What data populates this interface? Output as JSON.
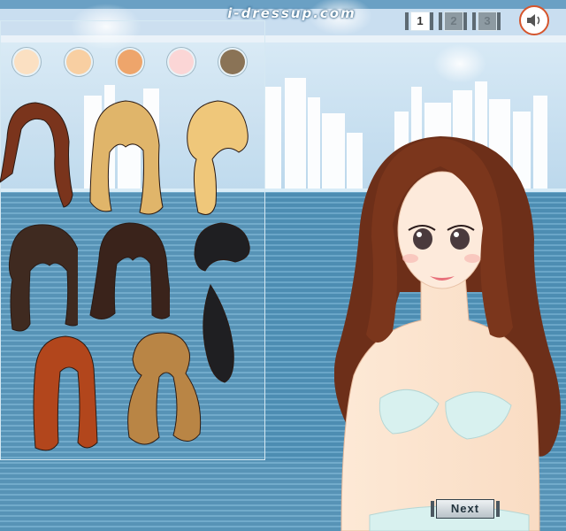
{
  "header": {
    "site_title": "i-dressup.com"
  },
  "pagination": {
    "pages": [
      "1",
      "2",
      "3"
    ],
    "current": "1"
  },
  "sound": {
    "icon": "speaker-icon"
  },
  "skin_tones": {
    "colors": [
      "#fbe0c2",
      "#f8cfa2",
      "#eea56b",
      "#fbd6d6",
      "#8a7356"
    ]
  },
  "hair_options": [
    {
      "name": "long-wavy-auburn",
      "color": "#7a341c"
    },
    {
      "name": "long-wavy-blonde",
      "color": "#e0b56a"
    },
    {
      "name": "side-ponytail-blonde",
      "color": "#efc77a"
    },
    {
      "name": "twin-curls-dark-brown",
      "color": "#3f2a20"
    },
    {
      "name": "long-straight-dark-brown",
      "color": "#3a231b"
    },
    {
      "name": "side-swept-black",
      "color": "#1f1f22"
    },
    {
      "name": "bob-ginger",
      "color": "#b2461c"
    },
    {
      "name": "wavy-light-brown",
      "color": "#b98545"
    }
  ],
  "controls": {
    "next_label": "Next"
  }
}
